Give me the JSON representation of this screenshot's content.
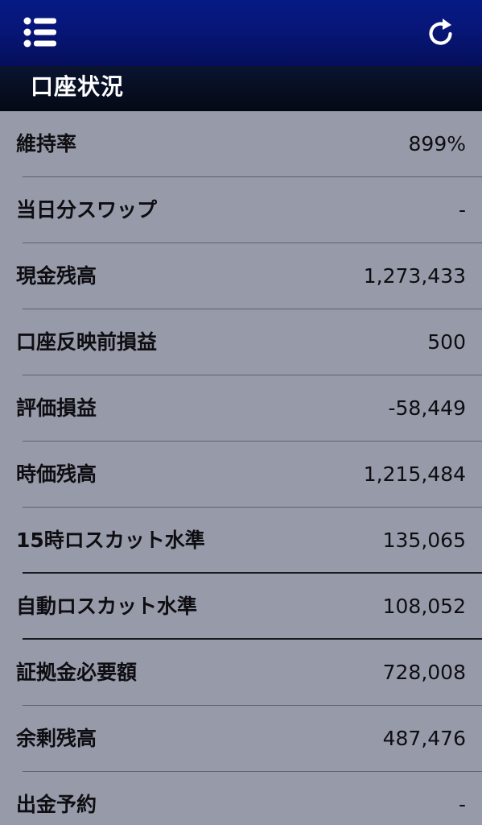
{
  "header": {
    "menu_icon": "list-menu-icon",
    "refresh_icon": "refresh-icon",
    "title": "口座状況"
  },
  "rows": [
    {
      "label": "維持率",
      "value": "899%"
    },
    {
      "label": "当日分スワップ",
      "value": "-"
    },
    {
      "label": "現金残高",
      "value": "1,273,433"
    },
    {
      "label": "口座反映前損益",
      "value": "500"
    },
    {
      "label": "評価損益",
      "value": "-58,449"
    },
    {
      "label": "時価残高",
      "value": "1,215,484"
    },
    {
      "label": "15時ロスカット水準",
      "value": "135,065"
    },
    {
      "label": "自動ロスカット水準",
      "value": "108,052"
    },
    {
      "label": "証拠金必要額",
      "value": "728,008"
    },
    {
      "label": "余剰残高",
      "value": "487,476"
    },
    {
      "label": "出金予約",
      "value": "-"
    }
  ],
  "colors": {
    "navbar": "#071677",
    "title_bar": "#060c1d",
    "background": "#979ba9",
    "text": "#0e0e12",
    "title_text": "#ffffff"
  }
}
